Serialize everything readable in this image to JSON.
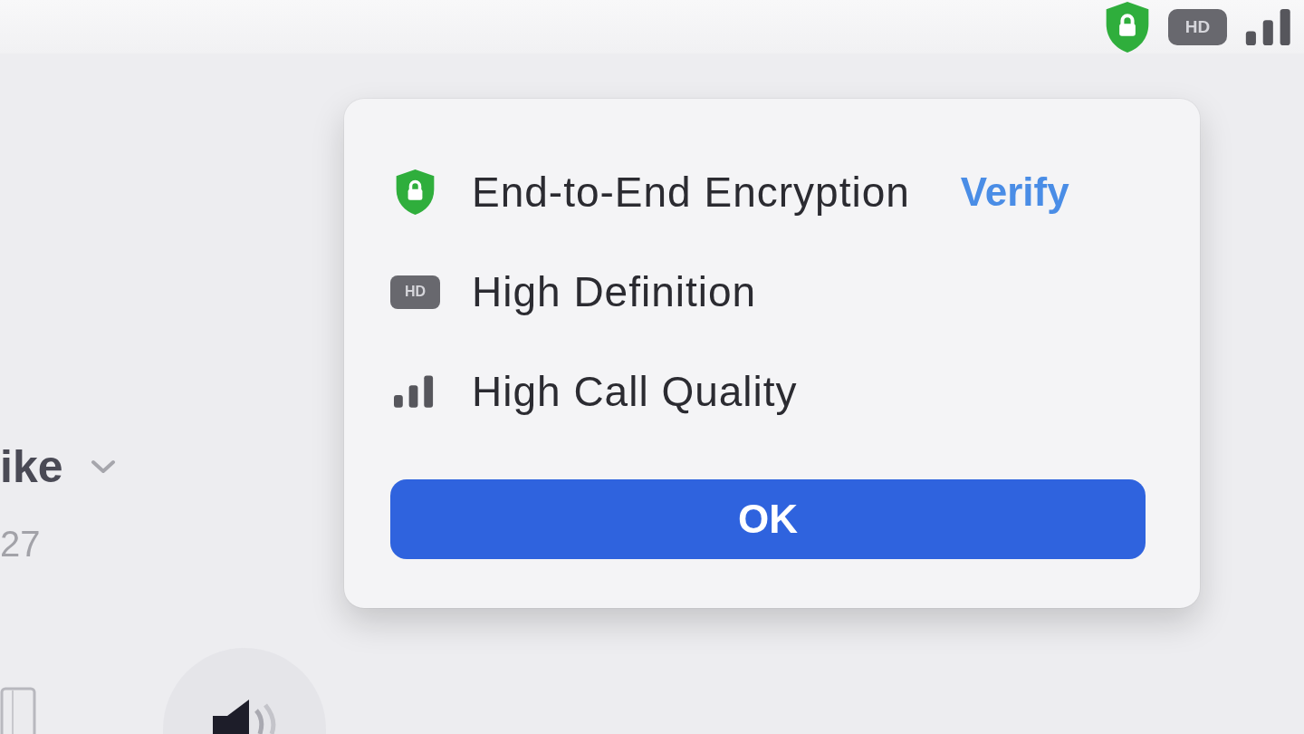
{
  "status_bar": {
    "indicators": [
      {
        "kind": "shield"
      },
      {
        "kind": "hd",
        "label": "HD"
      },
      {
        "kind": "signal"
      }
    ]
  },
  "participant": {
    "name": "ike",
    "subtitle": "27"
  },
  "popup": {
    "items": [
      {
        "kind": "shield",
        "label": "End-to-End Encryption",
        "link": "Verify"
      },
      {
        "kind": "hd",
        "badge": "HD",
        "label": "High Definition"
      },
      {
        "kind": "signal",
        "label": "High Call Quality"
      }
    ],
    "button": "OK"
  },
  "controls": [
    {
      "kind": "frame"
    },
    {
      "kind": "speaker"
    }
  ]
}
